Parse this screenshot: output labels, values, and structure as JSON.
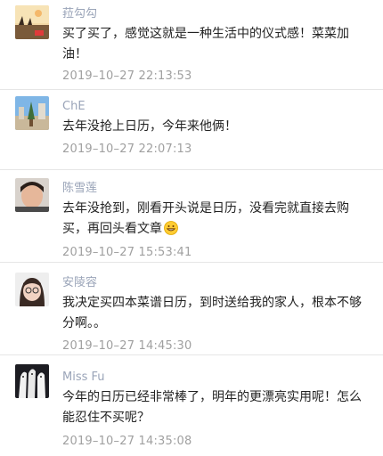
{
  "comments": [
    {
      "name": "菈勾勾",
      "text": "买了买了，感觉这就是一种生活中的仪式感！菜菜加油！",
      "time": "2019–10–27 22:13:53",
      "avatar_icon": "rice-field-silhouette-avatar"
    },
    {
      "name": "ChE",
      "text": "去年没抢上日历，今年来他俩！",
      "time": "2019–10–27 22:07:13",
      "avatar_icon": "blue-sky-street-avatar"
    },
    {
      "name": "陈雪莲",
      "text": "去年没抢到，刚看开头说是日历，没看完就直接去购买，再回头看文章",
      "time": "2019–10–27 15:53:41",
      "avatar_icon": "person-portrait-avatar",
      "trailing_emoji": "grinning-emoji-icon"
    },
    {
      "name": "安陵容",
      "text": "我决定买四本菜谱日历，到时送给我的家人，根本不够分啊。。",
      "time": "2019–10–27 14:45:30",
      "avatar_icon": "girl-portrait-avatar"
    },
    {
      "name": "Miss Fu",
      "text": "今年的日历已经非常棒了，明年的更漂亮实用呢！怎么能忍住不买呢？",
      "time": "2019–10–27 14:35:08",
      "avatar_icon": "white-horses-avatar"
    }
  ]
}
